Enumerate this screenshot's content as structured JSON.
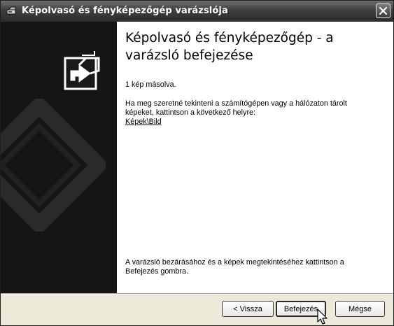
{
  "window": {
    "title": "Képolvasó és fényképezőgép varázslója"
  },
  "content": {
    "heading": "Képolvasó és fényképezőgép - a varázsló befejezése",
    "copied_text": "1 kép másolva.",
    "info_text": "Ha meg szeretné tekinteni a számítógépen vagy a hálózaton tárolt képeket, kattintson a következő helyre:",
    "link_text": "Képek\\Bild",
    "close_info_text": "A varázsló bezárásához és a képek megtekintéséhez kattintson a Befejezés gombra."
  },
  "buttons": {
    "back": "< Vissza",
    "finish": "Befejezés",
    "cancel": "Mégse"
  },
  "icons": {
    "title": "scanner-camera-icon",
    "close": "close-icon",
    "logo": "wizard-arrow-icon",
    "cursor": "mouse-pointer-icon"
  },
  "colors": {
    "titlebar": "#3f3f3f",
    "sidepanel": "#151515",
    "content": "#ffffff",
    "dialog": "#ece9d8"
  }
}
